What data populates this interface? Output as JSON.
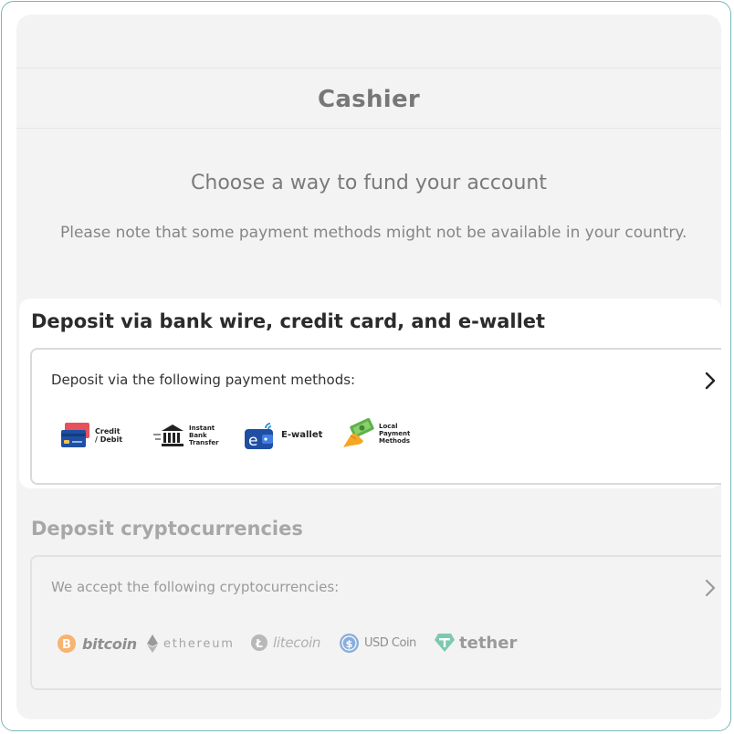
{
  "header": {
    "title": "Cashier"
  },
  "intro": {
    "subtitle": "Choose a way to fund your account",
    "note": "Please note that some payment methods might not be available in your country."
  },
  "bank_section": {
    "heading": "Deposit via bank wire, credit card, and e-wallet",
    "box_label": "Deposit via the following payment methods:",
    "methods": [
      {
        "icon": "credit-card-icon",
        "lines": [
          "Credit",
          "/ Debit"
        ]
      },
      {
        "icon": "bank-icon",
        "lines": [
          "Instant",
          "Bank",
          "Transfer"
        ]
      },
      {
        "icon": "e-wallet-icon",
        "lines": [
          "E-wallet"
        ]
      },
      {
        "icon": "cash-hand-icon",
        "lines": [
          "Local",
          "Payment",
          "Methods"
        ]
      }
    ]
  },
  "crypto_section": {
    "heading": "Deposit cryptocurrencies",
    "box_label": "We accept the following cryptocurrencies:",
    "coins": [
      {
        "icon": "bitcoin-icon",
        "label": "bitcoin",
        "color": "#f7b370"
      },
      {
        "icon": "ethereum-icon",
        "label": "ethereum",
        "color": "#9a9a9a"
      },
      {
        "icon": "litecoin-icon",
        "label": "litecoin",
        "color": "#b8b8b8"
      },
      {
        "icon": "usd-coin-icon",
        "label": "USD Coin",
        "color": "#8aaedb"
      },
      {
        "icon": "tether-icon",
        "label": "tether",
        "color": "#7cc9b0"
      }
    ]
  },
  "colors": {
    "frame_border": "#7fb5b5",
    "panel_bg": "#f3f3f3"
  }
}
